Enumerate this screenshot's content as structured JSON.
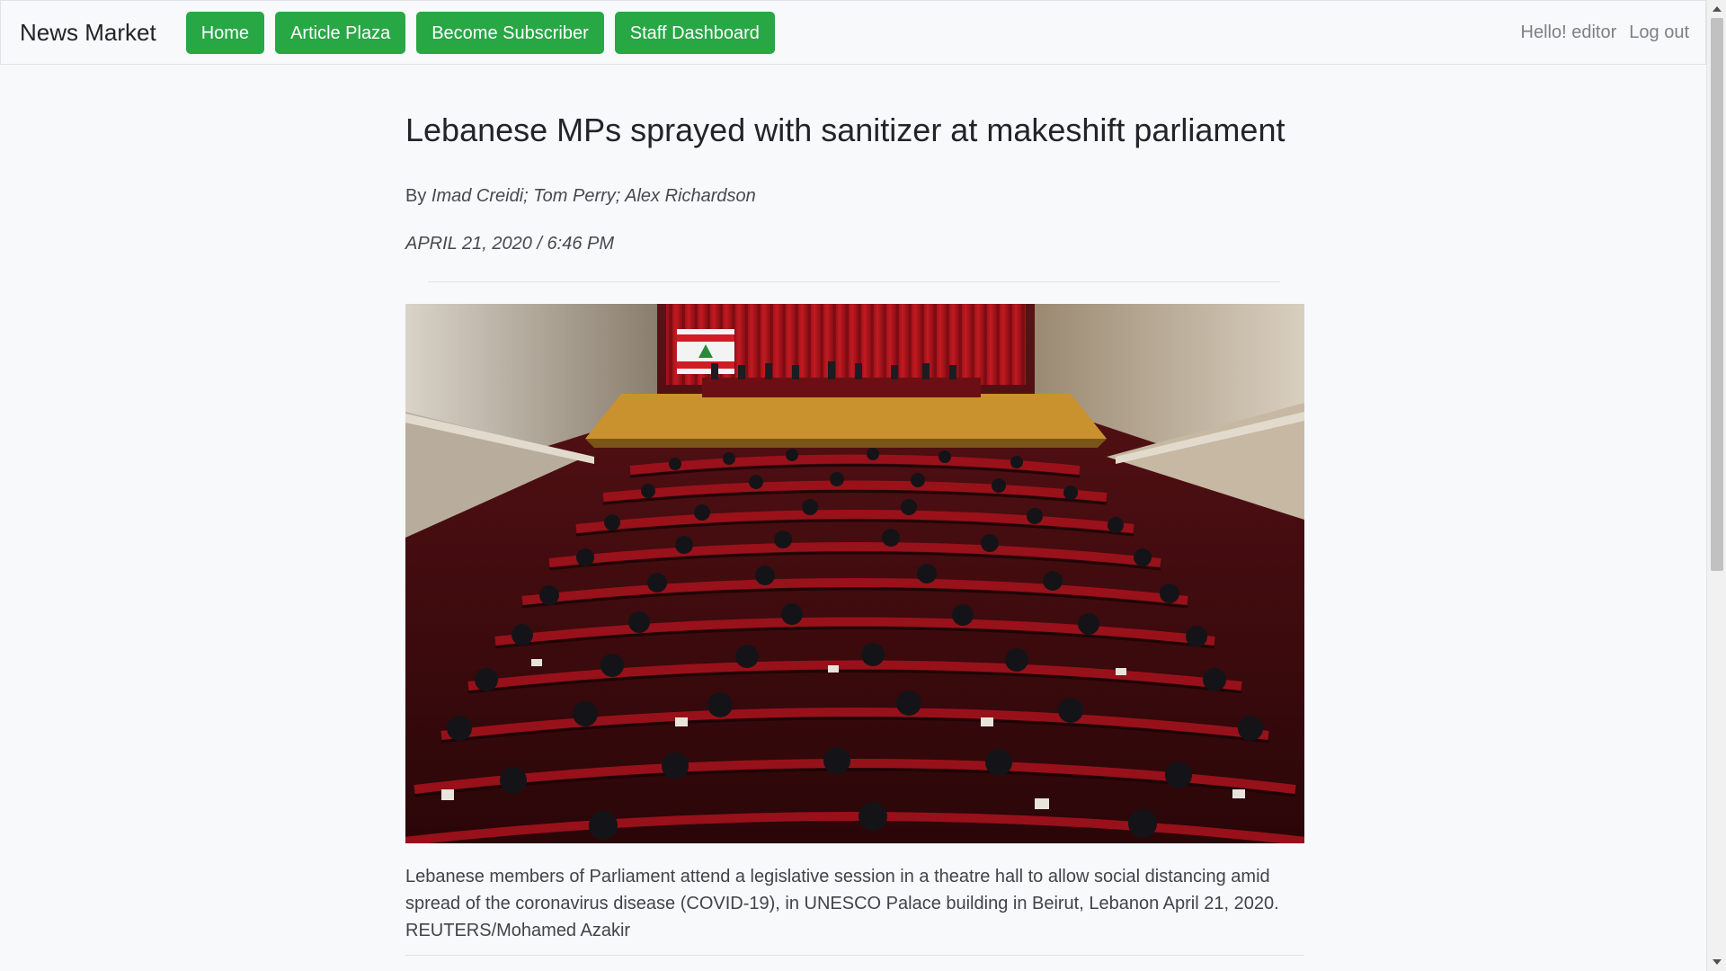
{
  "navbar": {
    "brand": "News Market",
    "buttons": [
      "Home",
      "Article Plaza",
      "Become Subscriber",
      "Staff Dashboard"
    ],
    "greeting": "Hello! editor",
    "logout": "Log out"
  },
  "article": {
    "headline": "Lebanese MPs sprayed with sanitizer at makeshift parliament",
    "by_prefix": "By",
    "authors": "Imad Creidi; Tom Perry; Alex Richardson",
    "dateline": "APRIL 21, 2020 / 6:46 PM",
    "caption": "Lebanese members of Parliament attend a legislative session in a theatre hall to allow social distancing amid spread of the coronavirus disease (COVID-19), in UNESCO Palace building in Beirut, Lebanon April 21, 2020. REUTERS/Mohamed Azakir"
  },
  "colors": {
    "accent": "#28a745",
    "background": "#f8f9fa",
    "text": "#212529"
  }
}
